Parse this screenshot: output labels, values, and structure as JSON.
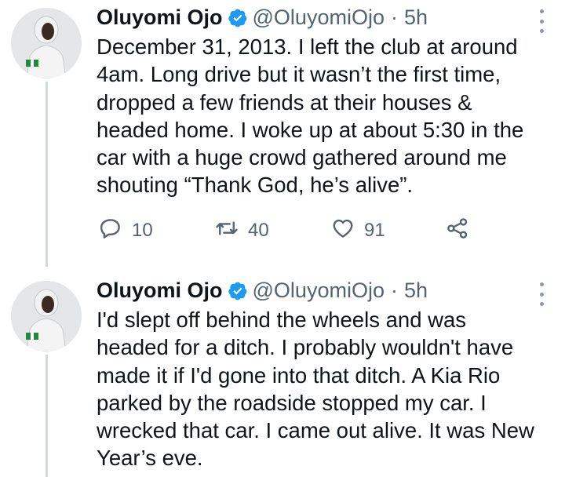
{
  "tweets": [
    {
      "author": "Oluyomi Ojo",
      "handle": "@OluyomiOjo",
      "separator": "·",
      "time": "5h",
      "text": "December 31, 2013. I left the club at around\n4am. Long drive but it wasn’t the first time,\ndropped a few friends at their houses &\nheaded home. I woke up at about 5:30 in the\ncar with a huge crowd gathered around me\nshouting “Thank God, he’s alive”.",
      "replies": "10",
      "retweets": "40",
      "likes": "91"
    },
    {
      "author": "Oluyomi Ojo",
      "handle": "@OluyomiOjo",
      "separator": "·",
      "time": "5h",
      "text": "I'd slept off behind the wheels and was\nheaded for a ditch. I probably wouldn't have\nmade it if I'd gone into that ditch. A Kia Rio\nparked by the roadside stopped my car. I\nwrecked that car. I came out alive. It was New\nYear’s eve."
    }
  ],
  "colors": {
    "text": "#0f1419",
    "secondary": "#536471",
    "verified": "#1d9bf0",
    "thread_line": "#cfd9de"
  },
  "icons": [
    "verified-badge-icon",
    "more-options-icon",
    "reply-icon",
    "retweet-icon",
    "like-icon",
    "share-icon"
  ]
}
